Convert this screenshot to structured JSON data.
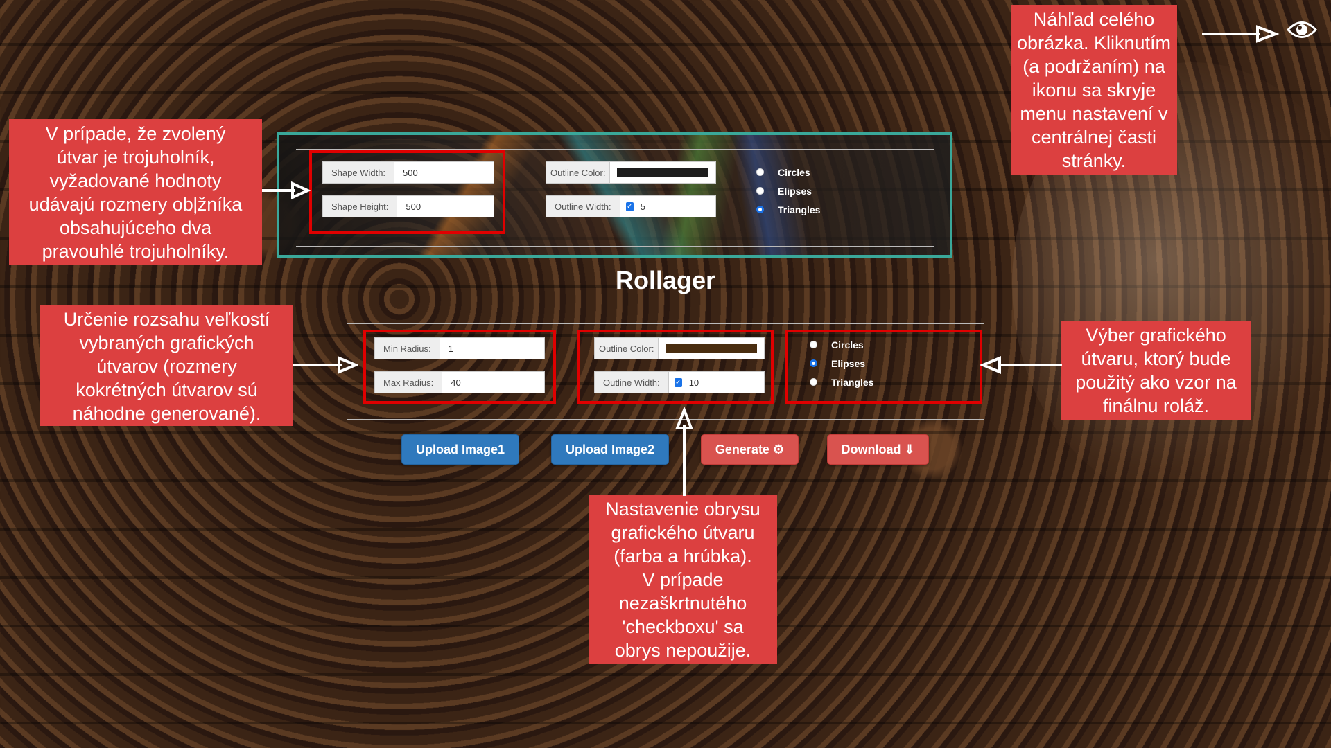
{
  "app": {
    "title": "Rollager"
  },
  "top_panel": {
    "shape_width": {
      "label": "Shape Width:",
      "value": "500"
    },
    "shape_height": {
      "label": "Shape Height:",
      "value": "500"
    },
    "outline_color": {
      "label": "Outline Color:",
      "color": "#1e1e1e"
    },
    "outline_width": {
      "label": "Outline Width:",
      "value": "5",
      "checked": true
    },
    "shapes": [
      "Circles",
      "Elipses",
      "Triangles"
    ],
    "selected_shape": "Triangles"
  },
  "main_panel": {
    "min_radius": {
      "label": "Min Radius:",
      "value": "1"
    },
    "max_radius": {
      "label": "Max Radius:",
      "value": "40"
    },
    "outline_color": {
      "label": "Outline Color:",
      "color": "#4a2e10"
    },
    "outline_width": {
      "label": "Outline Width:",
      "value": "10",
      "checked": true
    },
    "shapes": [
      "Circles",
      "Elipses",
      "Triangles"
    ],
    "selected_shape": "Elipses"
  },
  "buttons": {
    "upload1": "Upload Image1",
    "upload2": "Upload Image2",
    "generate": "Generate ⚙",
    "download": "Download ⇓"
  },
  "notes": {
    "triangle_note": "V prípade, že zvolený\nútvar je trojuholník,\nvyžadované hodnoty\nudávajú rozmery obļžníka\nobsahujúceho dva\npravouhlé trojuholníky.",
    "radius_note": "Určenie rozsahu veľkostí\nvybraných grafických\nútvarov (rozmery\nkokrétných útvarov sú\nnáhodne generované).",
    "preview_note": "Náhľad celého\nobrázka. Kliknutím\n(a podržaním) na\nikonu sa skryje\nmenu nastavení v\ncentrálnej časti\nstránky.",
    "shape_note": "Výber grafického\nútvaru, ktorý bude\npoužitý ako vzor na\nfinálnu roláž.",
    "outline_note": "Nastavenie obrysu\ngrafického útvaru\n(farba a hrúbka).\nV prípade\nnezaškrtnutého\n'checkboxu' sa\nobrys nepoužije."
  },
  "colors": {
    "annotation": "#dc4040",
    "highlight": "#e00000",
    "preview_border": "#3aa89a",
    "primary": "#2f79bd",
    "danger": "#d9534f"
  },
  "icons": {
    "preview": "eye-icon",
    "settings": "gear-icon",
    "download": "download-arrow-icon"
  }
}
